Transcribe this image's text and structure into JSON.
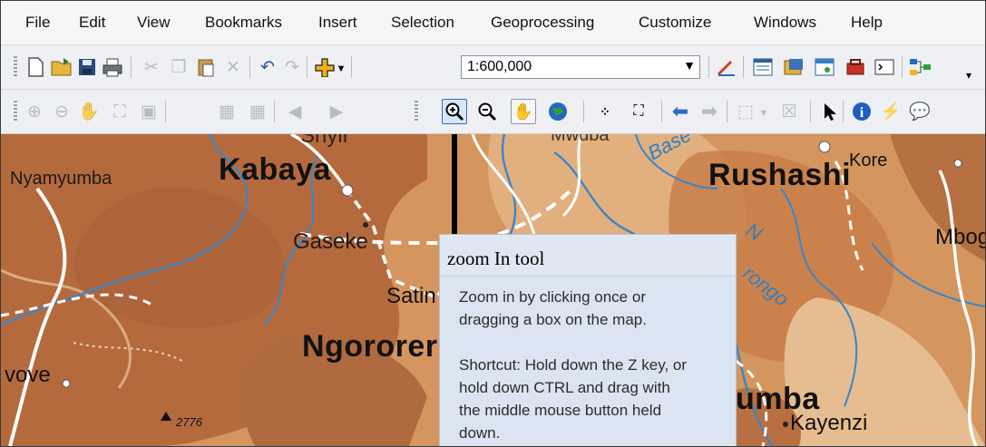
{
  "menu": [
    "File",
    "Edit",
    "View",
    "Bookmarks",
    "Insert",
    "Selection",
    "Geoprocessing",
    "Customize",
    "Windows",
    "Help"
  ],
  "toolbar": {
    "scale_value": "1:600,000",
    "standard_icons": [
      "new-document-icon",
      "open-folder-icon",
      "save-icon",
      "print-icon",
      "cut-icon",
      "copy-icon",
      "paste-icon",
      "delete-icon",
      "undo-icon",
      "redo-icon",
      "add-data-icon",
      "editor-icon",
      "table-of-contents-icon",
      "catalog-icon",
      "search-window-icon",
      "arctoolbox-icon",
      "python-icon",
      "model-builder-icon"
    ],
    "tools_icons": [
      "zoom-in-icon",
      "zoom-out-icon",
      "pan-icon",
      "full-extent-icon",
      "fixed-zoom-in-icon",
      "fixed-zoom-out-icon",
      "previous-extent-icon",
      "next-extent-icon",
      "select-features-icon",
      "clear-selection-icon",
      "select-elements-icon",
      "identify-icon",
      "hyperlink-icon",
      "html-popup-icon"
    ]
  },
  "map": {
    "labels": {
      "kabaya": "Kabaya",
      "rushashi": "Rushashi",
      "ngororero": "Ngororer",
      "gaseke": "Gaseke",
      "satin": "Satin",
      "nyamyumba": "Nyamyumba",
      "kore": "Kore",
      "mbog": "Mbog",
      "vove": "vove",
      "umba": "umba",
      "kayenzi": "Kayenzi",
      "elevation": "2776",
      "base": "Base",
      "nyabarongo": "rongo",
      "n_letter": "N",
      "top_left": "Shyir",
      "top_mid": "Mwuba"
    },
    "colors": {
      "land_dark": "#b46b3f",
      "land_light": "#d79b68",
      "water": "#3a86c8",
      "road": "#ffffff"
    }
  },
  "tooltip": {
    "title": "zoom In tool",
    "body": [
      "Zoom in by clicking once or",
      "dragging a box on the map.",
      "",
      "Shortcut: Hold down the Z key, or",
      "hold down CTRL and drag with",
      "the middle mouse button held",
      "down."
    ]
  }
}
